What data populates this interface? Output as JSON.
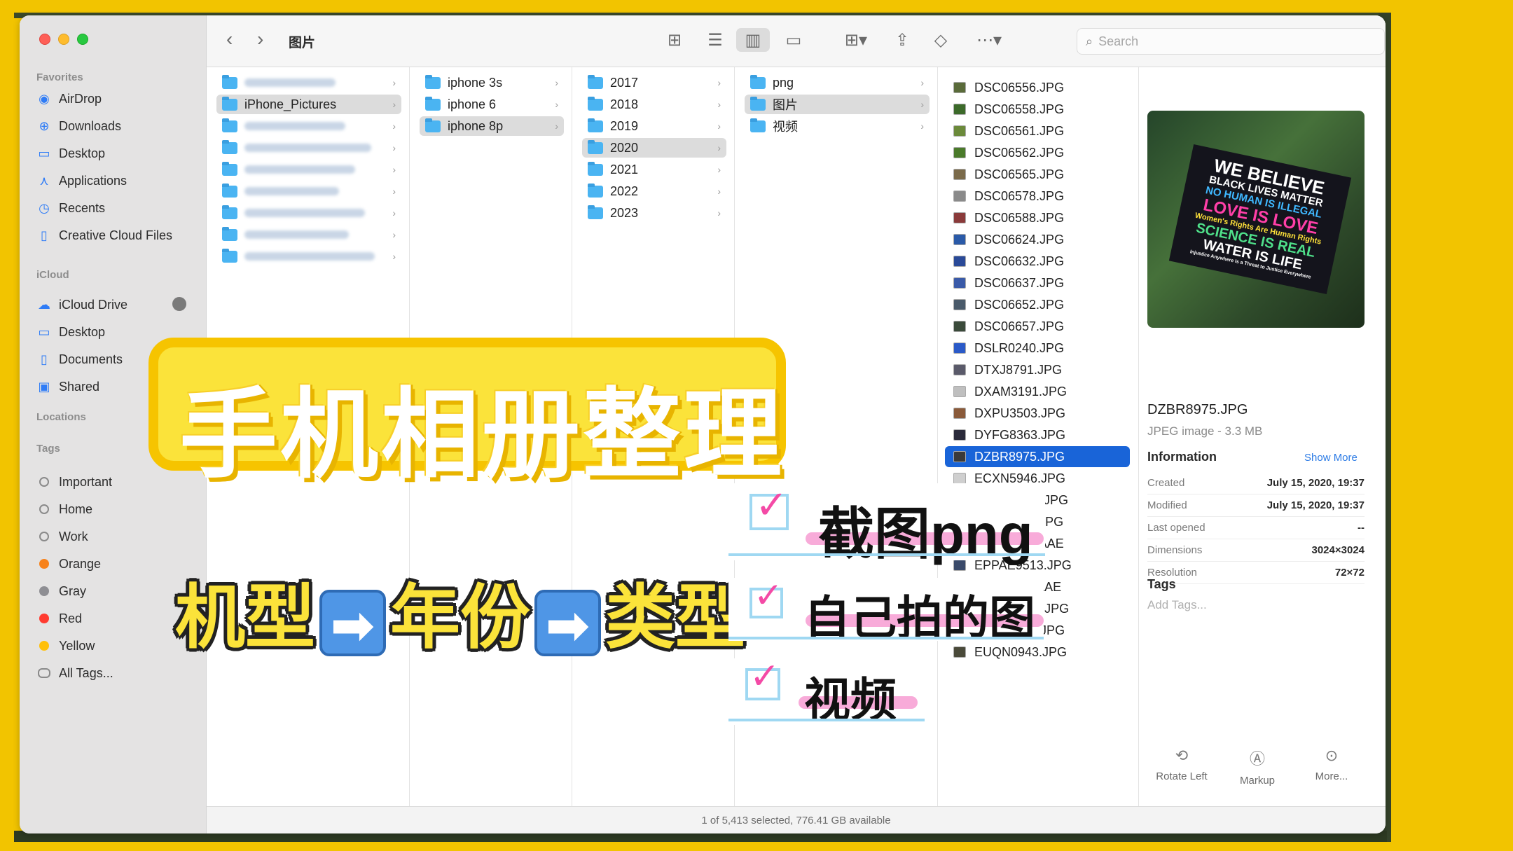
{
  "window": {
    "folder_title": "图片",
    "search_placeholder": "Search",
    "status": "1 of 5,413 selected, 776.41 GB available"
  },
  "sidebar": {
    "favorites_label": "Favorites",
    "favorites": [
      {
        "label": "AirDrop",
        "icon": "airdrop-icon"
      },
      {
        "label": "Downloads",
        "icon": "downloads-icon"
      },
      {
        "label": "Desktop",
        "icon": "desktop-icon"
      },
      {
        "label": "Applications",
        "icon": "applications-icon"
      },
      {
        "label": "Recents",
        "icon": "recents-icon"
      },
      {
        "label": "Creative Cloud Files",
        "icon": "document-icon"
      }
    ],
    "icloud_label": "iCloud",
    "icloud": [
      {
        "label": "iCloud Drive",
        "icon": "cloud-icon"
      },
      {
        "label": "Desktop",
        "icon": "desktop-icon"
      },
      {
        "label": "Documents",
        "icon": "document-icon"
      },
      {
        "label": "Shared",
        "icon": "shared-folder-icon"
      }
    ],
    "locations_label": "Locations",
    "tags_label": "Tags",
    "tags": [
      {
        "label": "Important",
        "color": "hollow"
      },
      {
        "label": "Home",
        "color": "hollow"
      },
      {
        "label": "Work",
        "color": "hollow"
      },
      {
        "label": "Orange",
        "color": "#f7821b"
      },
      {
        "label": "Gray",
        "color": "#8e8e93"
      },
      {
        "label": "Red",
        "color": "#ff3b30"
      },
      {
        "label": "Yellow",
        "color": "#ffc00a"
      },
      {
        "label": "All Tags...",
        "color": "all"
      }
    ]
  },
  "columns": {
    "col1": [
      "",
      "iPhone_Pictures",
      "",
      "",
      "",
      "",
      "",
      "",
      ""
    ],
    "col2": [
      "iphone 3s",
      "iphone 6",
      "iphone 8p"
    ],
    "col3": [
      "2017",
      "2018",
      "2019",
      "2020",
      "2021",
      "2022",
      "2023"
    ],
    "col4": [
      "png",
      "图片",
      "视频"
    ]
  },
  "files": [
    "DSC06556.JPG",
    "DSC06558.JPG",
    "DSC06561.JPG",
    "DSC06562.JPG",
    "DSC06565.JPG",
    "DSC06578.JPG",
    "DSC06588.JPG",
    "DSC06624.JPG",
    "DSC06632.JPG",
    "DSC06637.JPG",
    "DSC06652.JPG",
    "DSC06657.JPG",
    "DSLR0240.JPG",
    "DTXJ8791.JPG",
    "DXAM3191.JPG",
    "DXPU3503.JPG",
    "DYFG8363.JPG",
    "DZBR8975.JPG",
    "ECXN5946.JPG",
    "ENWK5032.JPG",
    "ENXL7051.JPG",
    "EPPA9513.AAE",
    "EPPAE9513.JPG",
    "ESIO5364.AAE",
    "ESIOE5364.JPG",
    "ESXD5462.JPG",
    "EUQN0943.JPG"
  ],
  "selected_file_index": 17,
  "preview": {
    "sign_lines": [
      "WE BELIEVE",
      "BLACK LIVES MATTER",
      "NO HUMAN IS ILLEGAL",
      "LOVE IS LOVE",
      "Women's Rights Are Human Rights",
      "SCIENCE IS REAL",
      "WATER IS LIFE",
      "Injustice Anywhere is a Threat to Justice Everywhere"
    ],
    "filename": "DZBR8975.JPG",
    "kind": "JPEG image - 3.3 MB",
    "info_label": "Information",
    "show_more": "Show More",
    "rows": [
      {
        "k": "Created",
        "v": "July 15, 2020, 19:37"
      },
      {
        "k": "Modified",
        "v": "July 15, 2020, 19:37"
      },
      {
        "k": "Last opened",
        "v": "--"
      },
      {
        "k": "Dimensions",
        "v": "3024×3024"
      },
      {
        "k": "Resolution",
        "v": "72×72"
      }
    ],
    "tags_label": "Tags",
    "add_tags": "Add Tags...",
    "actions": [
      "Rotate Left",
      "Markup",
      "More..."
    ]
  },
  "overlay": {
    "title": "手机相册整理",
    "flow": [
      "机型",
      "年份",
      "类型"
    ],
    "arrow": "➡",
    "checks": [
      "截图png",
      "自己拍的图",
      "视频"
    ]
  }
}
